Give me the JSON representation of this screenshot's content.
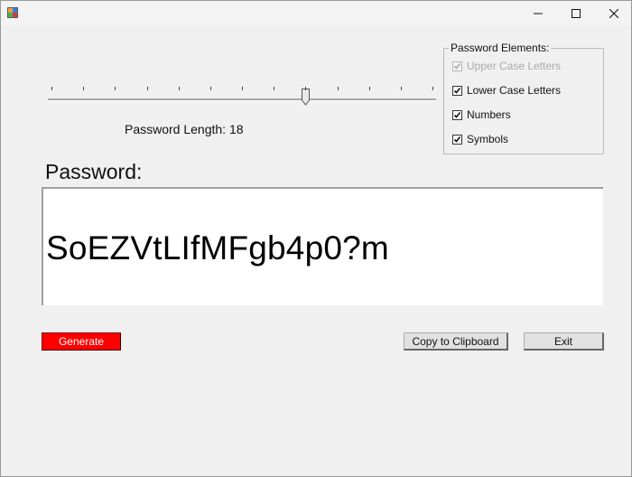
{
  "window": {
    "icon": "app-icon",
    "controls": {
      "minimize": "minimize-icon",
      "maximize": "maximize-icon",
      "close": "close-icon"
    }
  },
  "slider": {
    "min": 6,
    "max": 24,
    "value": 18,
    "tick_count": 13
  },
  "length_label": "Password Length: 18",
  "elements_group": {
    "title": "Password Elements:",
    "options": [
      {
        "label": "Upper Case Letters",
        "checked": true,
        "enabled": false
      },
      {
        "label": "Lower Case Letters",
        "checked": true,
        "enabled": true
      },
      {
        "label": "Numbers",
        "checked": true,
        "enabled": true
      },
      {
        "label": "Symbols",
        "checked": true,
        "enabled": true
      }
    ]
  },
  "password": {
    "heading": "Password:",
    "value": "SoEZVtLIfMFgb4p0?m"
  },
  "buttons": {
    "generate": "Generate",
    "copy": "Copy to Clipboard",
    "exit": "Exit"
  },
  "colors": {
    "generate_bg": "#ff0000",
    "window_bg": "#f0f0f0"
  }
}
